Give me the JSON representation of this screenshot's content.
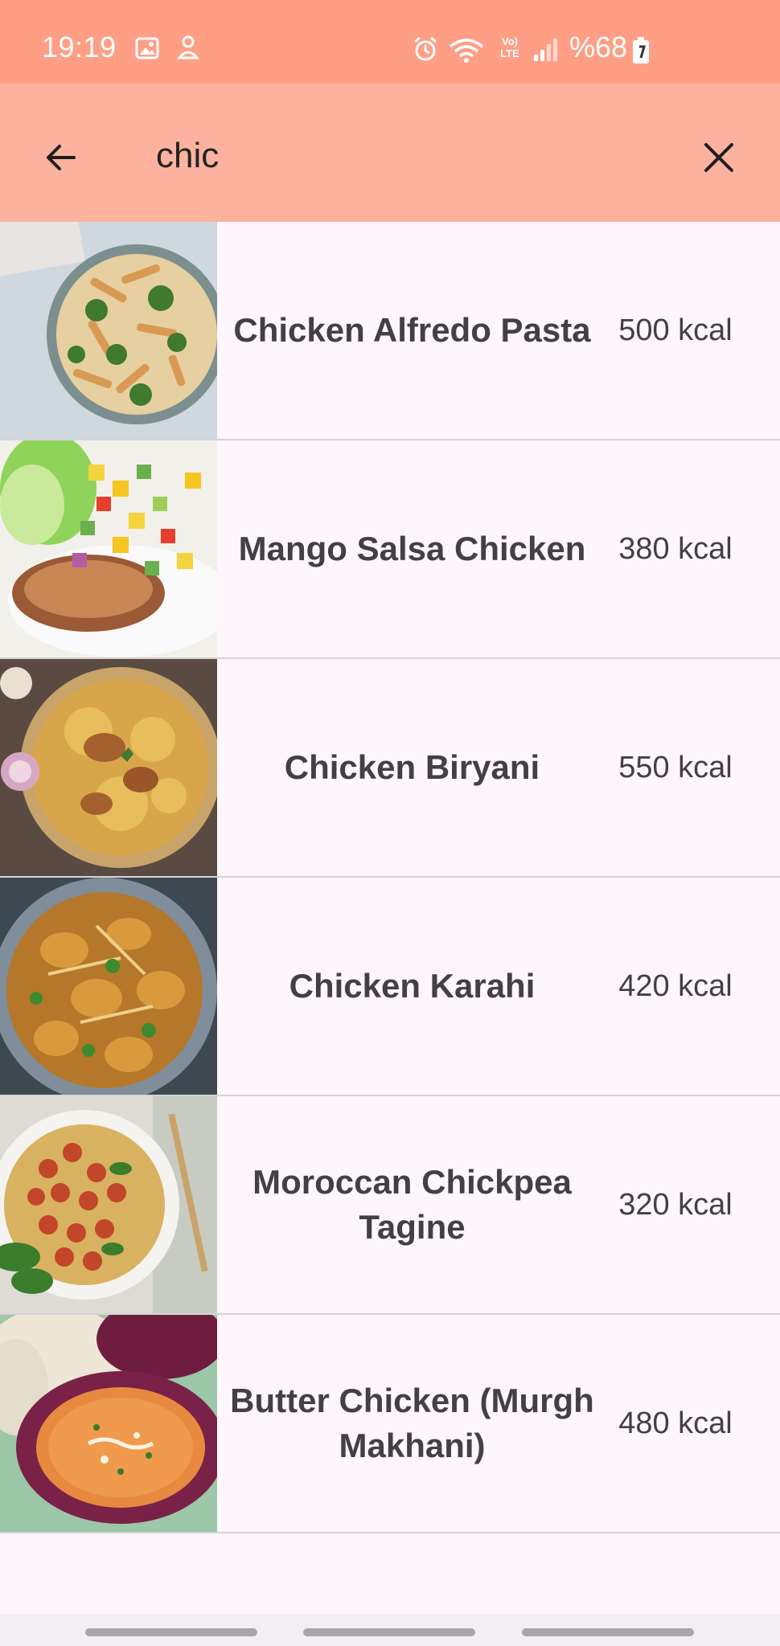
{
  "status_bar": {
    "time": "19:19",
    "battery": "%68",
    "network_label": "Vo) LTE",
    "bg_color": "#fe9f85"
  },
  "app_bar": {
    "back_icon": "arrow-left-icon",
    "search_value": "chic",
    "clear_icon": "close-icon",
    "bg_color": "#fcb29e"
  },
  "recipes": [
    {
      "name": "Chicken Alfredo Pasta",
      "kcal": "500 kcal",
      "image": "pasta-bowl"
    },
    {
      "name": "Mango Salsa Chicken",
      "kcal": "380 kcal",
      "image": "mango-salsa-chicken"
    },
    {
      "name": "Chicken Biryani",
      "kcal": "550 kcal",
      "image": "biryani-platter"
    },
    {
      "name": "Chicken Karahi",
      "kcal": "420 kcal",
      "image": "karahi-pan"
    },
    {
      "name": "Moroccan Chickpea Tagine",
      "kcal": "320 kcal",
      "image": "chickpea-tagine-bowl"
    },
    {
      "name": "Butter Chicken (Murgh Makhani)",
      "kcal": "480 kcal",
      "image": "butter-chicken-bowl"
    }
  ]
}
